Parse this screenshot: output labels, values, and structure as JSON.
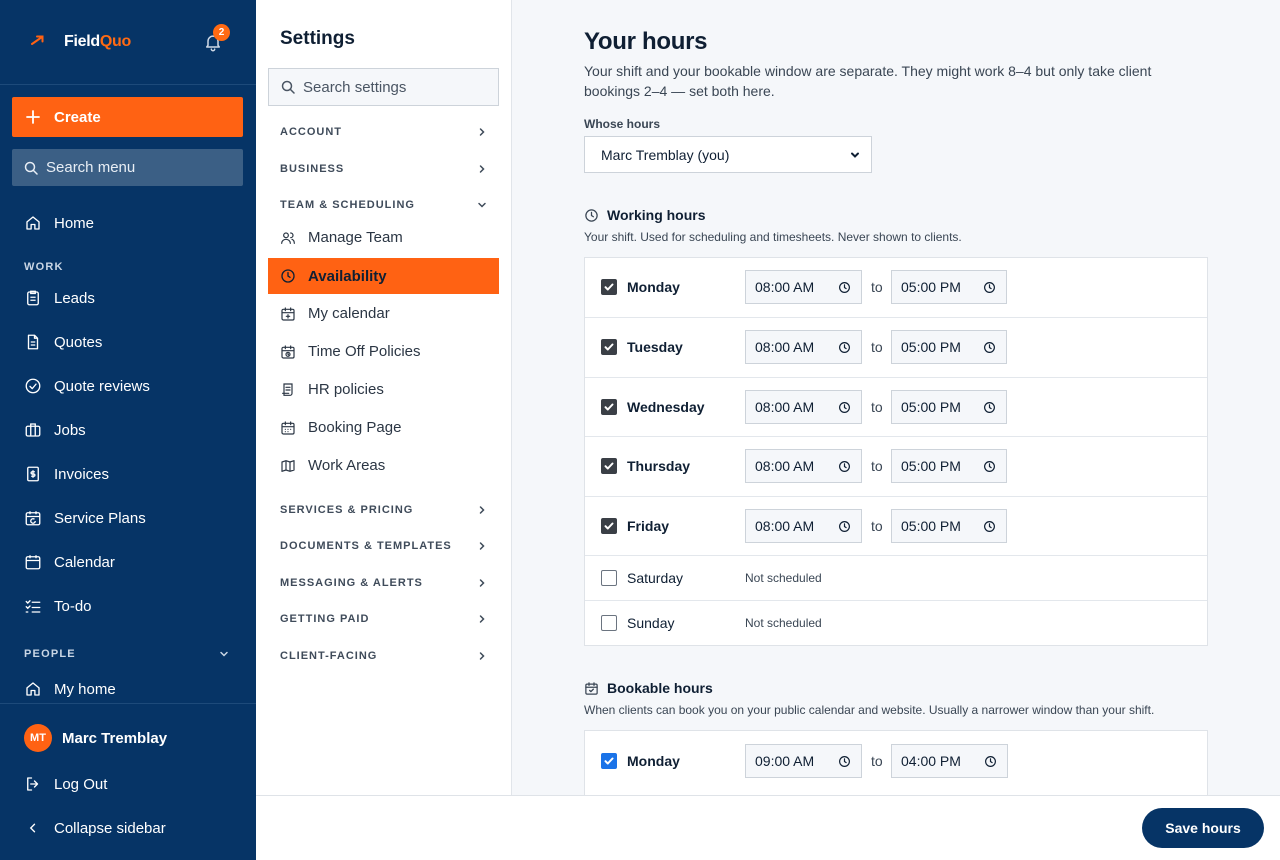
{
  "app": {
    "brand_part1": "Field",
    "brand_part2": "Quo",
    "notification_count": "2",
    "accent_color": "#ff6213",
    "sidebar_color": "#063466"
  },
  "sidebar": {
    "create_label": "Create",
    "search_placeholder": "Search menu",
    "home": "Home",
    "work_section": "WORK",
    "work_items": [
      "Leads",
      "Quotes",
      "Quote reviews",
      "Jobs",
      "Invoices",
      "Service Plans",
      "Calendar",
      "To-do"
    ],
    "people_section": "PEOPLE",
    "people_items": [
      "My home"
    ],
    "user_initials": "MT",
    "user_name": "Marc Tremblay",
    "logout": "Log Out",
    "collapse": "Collapse sidebar"
  },
  "settings": {
    "title": "Settings",
    "search_placeholder": "Search settings",
    "sections": {
      "account": "ACCOUNT",
      "business": "BUSINESS",
      "team": "TEAM & SCHEDULING",
      "services": "SERVICES & PRICING",
      "documents": "DOCUMENTS & TEMPLATES",
      "messaging": "MESSAGING & ALERTS",
      "paid": "GETTING PAID",
      "client": "CLIENT-FACING"
    },
    "team_items": {
      "manage_team": "Manage Team",
      "availability": "Availability",
      "my_calendar": "My calendar",
      "time_off": "Time Off Policies",
      "hr": "HR policies",
      "booking": "Booking Page",
      "work_areas": "Work Areas"
    }
  },
  "main": {
    "title": "Your hours",
    "description": "Your shift and your bookable window are separate. They might work 8–4 but only take client bookings 2–4 — set both here.",
    "whose_label": "Whose hours",
    "whose_value": "Marc Tremblay (you)",
    "to_label": "to",
    "not_scheduled": "Not scheduled",
    "working": {
      "title": "Working hours",
      "description": "Your shift. Used for scheduling and timesheets. Never shown to clients.",
      "days": [
        {
          "day": "Monday",
          "checked": true,
          "start": "08:00 AM",
          "end": "05:00 PM"
        },
        {
          "day": "Tuesday",
          "checked": true,
          "start": "08:00 AM",
          "end": "05:00 PM"
        },
        {
          "day": "Wednesday",
          "checked": true,
          "start": "08:00 AM",
          "end": "05:00 PM"
        },
        {
          "day": "Thursday",
          "checked": true,
          "start": "08:00 AM",
          "end": "05:00 PM"
        },
        {
          "day": "Friday",
          "checked": true,
          "start": "08:00 AM",
          "end": "05:00 PM"
        },
        {
          "day": "Saturday",
          "checked": false
        },
        {
          "day": "Sunday",
          "checked": false
        }
      ]
    },
    "bookable": {
      "title": "Bookable hours",
      "description": "When clients can book you on your public calendar and website. Usually a narrower window than your shift.",
      "days": [
        {
          "day": "Monday",
          "checked": true,
          "start": "09:00 AM",
          "end": "04:00 PM"
        }
      ]
    }
  },
  "footer": {
    "save_label": "Save hours"
  }
}
